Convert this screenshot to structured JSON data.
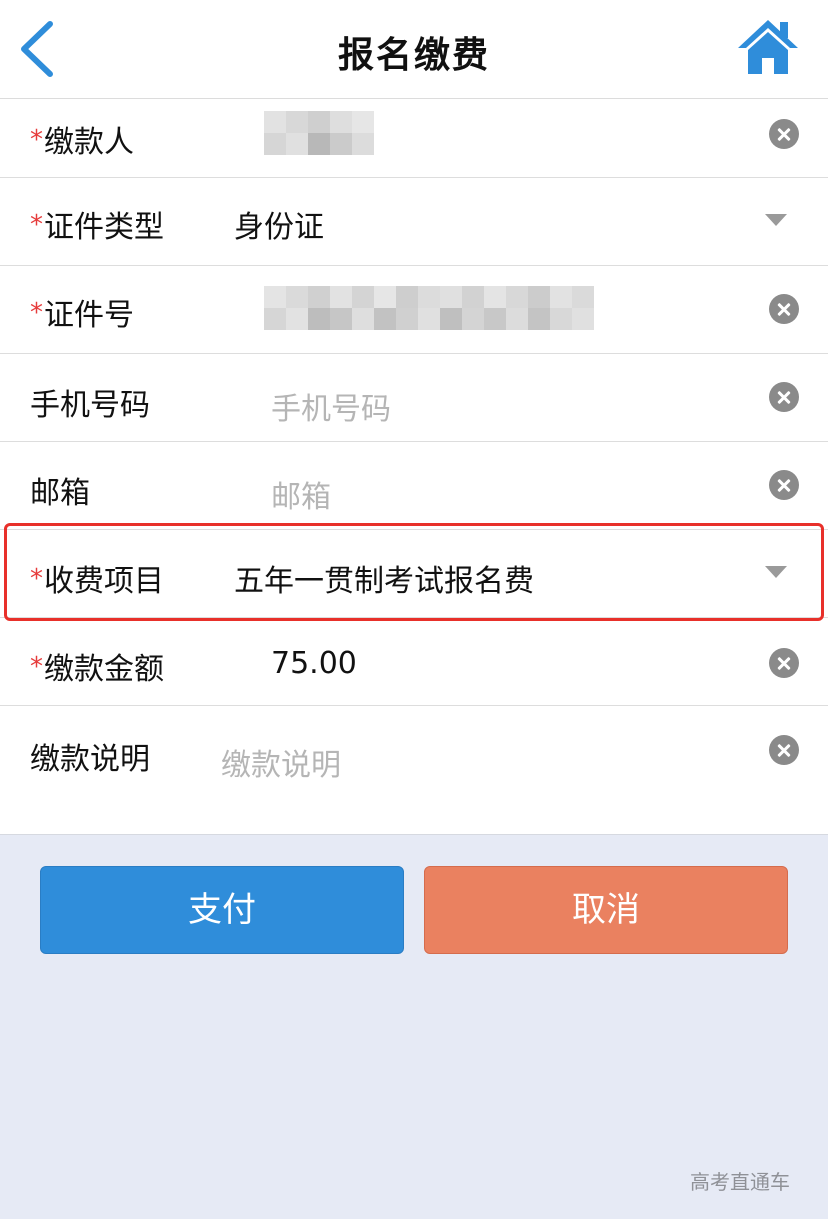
{
  "header": {
    "title": "报名缴费",
    "back_icon": "chevron-left-icon",
    "home_icon": "home-icon",
    "accent_color": "#2f8dda"
  },
  "form": {
    "required_mark": "*",
    "payer": {
      "label": "缴款人",
      "required": true,
      "value_state": "blurred"
    },
    "id_type": {
      "label": "证件类型",
      "required": true,
      "value": "身份证"
    },
    "id_number": {
      "label": "证件号",
      "required": true,
      "value_state": "blurred"
    },
    "phone": {
      "label": "手机号码",
      "required": false,
      "placeholder": "手机号码"
    },
    "email": {
      "label": "邮箱",
      "required": false,
      "placeholder": "邮箱"
    },
    "fee_item": {
      "label": "收费项目",
      "required": true,
      "value": "五年一贯制考试报名费",
      "highlighted": true,
      "highlight_color": "#e8302a"
    },
    "amount": {
      "label": "缴款金额",
      "required": true,
      "value": "75.00"
    },
    "note": {
      "label": "缴款说明",
      "required": false,
      "placeholder": "缴款说明"
    }
  },
  "actions": {
    "pay_label": "支付",
    "cancel_label": "取消",
    "pay_color": "#2f8dda",
    "cancel_color": "#ea8160"
  },
  "watermark": "高考直通车"
}
